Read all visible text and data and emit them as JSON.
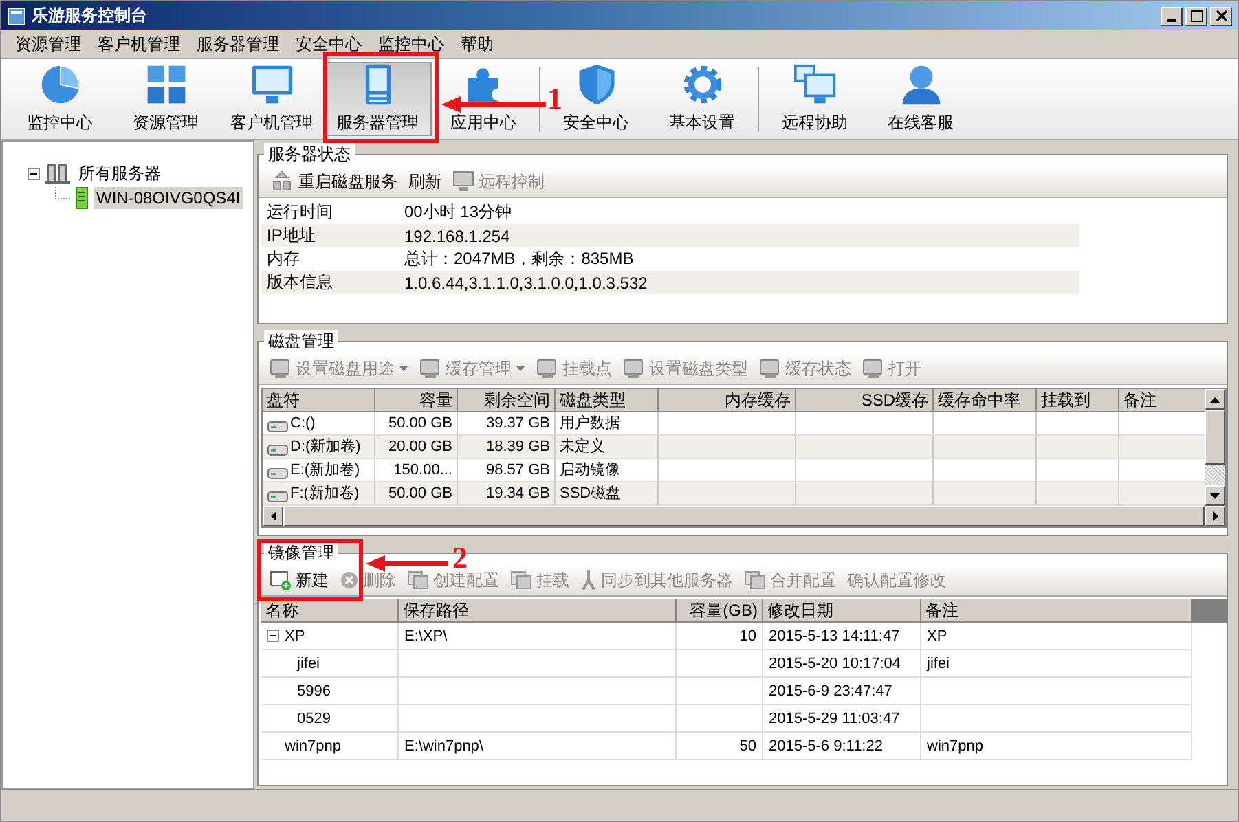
{
  "window": {
    "title": "乐游服务控制台"
  },
  "menu": [
    "资源管理",
    "客户机管理",
    "服务器管理",
    "安全中心",
    "监控中心",
    "帮助"
  ],
  "toolbar": {
    "groups": [
      [
        {
          "label": "监控中心",
          "selected": false
        },
        {
          "label": "资源管理",
          "selected": false
        },
        {
          "label": "客户机管理",
          "selected": false
        },
        {
          "label": "服务器管理",
          "selected": true
        },
        {
          "label": "应用中心",
          "selected": false
        }
      ],
      [
        {
          "label": "安全中心",
          "selected": false
        },
        {
          "label": "基本设置",
          "selected": false
        }
      ],
      [
        {
          "label": "远程协助",
          "selected": false
        },
        {
          "label": "在线客服",
          "selected": false
        }
      ]
    ]
  },
  "tree": {
    "label": "所有服务器",
    "expanded": true,
    "children": [
      {
        "label": "WIN-08OIVG0QS4I",
        "selected": true
      }
    ]
  },
  "server_status": {
    "title": "服务器状态",
    "actions": [
      {
        "label": "重启磁盘服务",
        "disabled": false
      },
      {
        "label": "刷新",
        "disabled": false
      },
      {
        "label": "远程控制",
        "disabled": true
      }
    ],
    "rows": [
      {
        "label": "运行时间",
        "value": "00小时 13分钟"
      },
      {
        "label": "IP地址",
        "value": "192.168.1.254"
      },
      {
        "label": "内存",
        "value": "总计：2047MB，剩余：835MB"
      },
      {
        "label": "版本信息",
        "value": "1.0.6.44,3.1.1.0,3.1.0.0,1.0.3.532"
      }
    ]
  },
  "disk_management": {
    "title": "磁盘管理",
    "actions": [
      {
        "label": "设置磁盘用途",
        "disabled": true,
        "dropdown": true
      },
      {
        "label": "缓存管理",
        "disabled": true,
        "dropdown": true
      },
      {
        "label": "挂载点",
        "disabled": true,
        "dropdown": false
      },
      {
        "label": "设置磁盘类型",
        "disabled": true,
        "dropdown": false
      },
      {
        "label": "缓存状态",
        "disabled": true,
        "dropdown": false
      },
      {
        "label": "打开",
        "disabled": true,
        "dropdown": false
      }
    ],
    "columns": [
      "盘符",
      "容量",
      "剩余空间",
      "磁盘类型",
      "内存缓存",
      "SSD缓存",
      "缓存命中率",
      "挂载到",
      "备注"
    ],
    "rows": [
      [
        "C:()",
        "50.00 GB",
        "39.37 GB",
        "用户数据"
      ],
      [
        "D:(新加卷)",
        "20.00 GB",
        "18.39 GB",
        "未定义"
      ],
      [
        "E:(新加卷)",
        "150.00...",
        "98.57 GB",
        "启动镜像"
      ],
      [
        "F:(新加卷)",
        "50.00 GB",
        "19.34 GB",
        "SSD磁盘"
      ]
    ]
  },
  "image_management": {
    "title": "镜像管理",
    "actions": [
      {
        "label": "新建",
        "disabled": false
      },
      {
        "label": "删除",
        "disabled": true
      },
      {
        "label": "创建配置",
        "disabled": true
      },
      {
        "label": "挂载",
        "disabled": true
      },
      {
        "label": "同步到其他服务器",
        "disabled": true
      },
      {
        "label": "合并配置",
        "disabled": true
      },
      {
        "label": "确认配置修改",
        "disabled": true
      }
    ],
    "columns": [
      "名称",
      "保存路径",
      "容量(GB)",
      "修改日期",
      "备注"
    ],
    "rows": [
      {
        "cells": [
          "XP",
          "E:\\XP\\",
          "10",
          "2015-5-13 14:11:47",
          "XP"
        ],
        "expanded": true,
        "children": [
          {
            "cells": [
              "jifei",
              "",
              "",
              "2015-5-20 10:17:04",
              "jifei"
            ]
          },
          {
            "cells": [
              "5996",
              "",
              "",
              "2015-6-9 23:47:47",
              ""
            ]
          },
          {
            "cells": [
              "0529",
              "",
              "",
              "2015-5-29 11:03:47",
              ""
            ]
          }
        ]
      },
      {
        "cells": [
          "win7pnp",
          "E:\\win7pnp\\",
          "50",
          "2015-5-6 9:11:22",
          "win7pnp"
        ]
      }
    ]
  },
  "annotations": [
    {
      "label": "1"
    },
    {
      "label": "2"
    }
  ]
}
